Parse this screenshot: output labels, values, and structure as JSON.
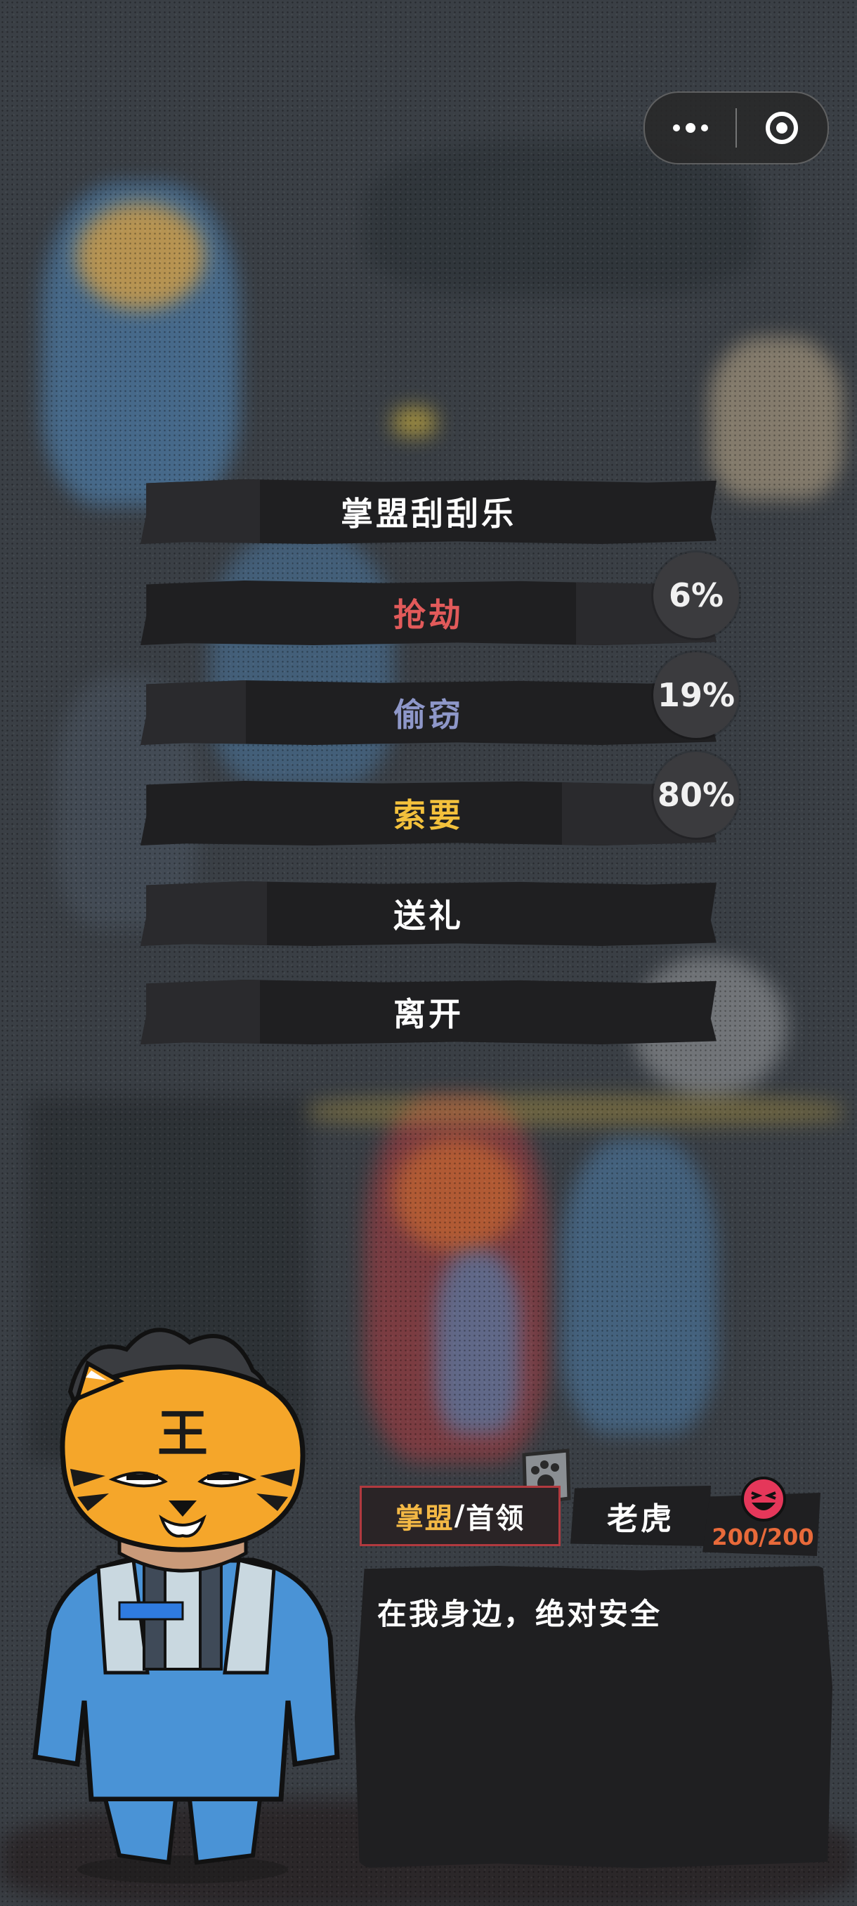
{
  "menu": {
    "title": "掌盟刮刮乐",
    "options": [
      {
        "label": "抢劫",
        "color": "#e25a5a",
        "chance": "6%"
      },
      {
        "label": "偷窃",
        "color": "#8e97c9",
        "chance": "19%"
      },
      {
        "label": "索要",
        "color": "#f3c13c",
        "chance": "80%"
      },
      {
        "label": "送礼",
        "color": "#ffffff"
      },
      {
        "label": "离开",
        "color": "#ffffff"
      }
    ]
  },
  "npc": {
    "faction": "掌盟",
    "separator": "/",
    "rank": "首领",
    "name": "老虎",
    "mask_glyph": "王",
    "hp": "200/200",
    "dialog": "在我身边，绝对安全"
  },
  "icons": {
    "more": "more-dots-icon",
    "close": "close-target-icon",
    "mood": "happy-face-icon",
    "badge": "paw-badge-icon"
  },
  "colors": {
    "panel": "#1f1f21",
    "accent_red": "#b13a3f",
    "faction_gold": "#f3b845",
    "hp_orange": "#e86a3a"
  }
}
